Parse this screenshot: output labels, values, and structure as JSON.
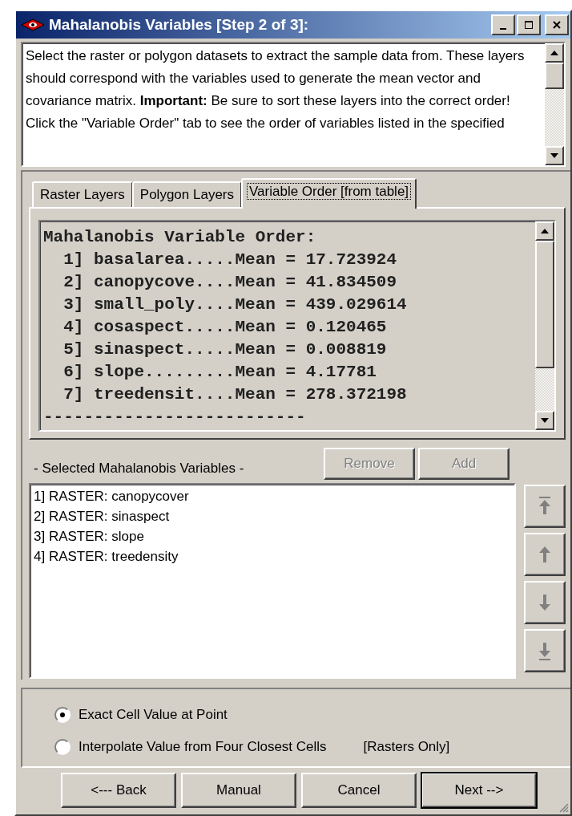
{
  "window": {
    "title": "Mahalanobis Variables [Step 2 of 3]:"
  },
  "description": {
    "text": "Select the raster or polygon datasets to extract the sample data from.  These layers should correspond with the variables used to generate the mean vector and covariance matrix. **Important:**  Be sure to sort these layers into the correct order!  Click the \"Variable Order\" tab to see the order of variables listed in the specified"
  },
  "tabs": [
    {
      "label": "Raster Layers",
      "selected": false
    },
    {
      "label": "Polygon Layers",
      "selected": false
    },
    {
      "label": "Variable Order [from table]",
      "selected": true
    }
  ],
  "variable_order": {
    "lines": [
      "Mahalanobis Variable Order:",
      "  1] basalarea.....Mean = 17.723924",
      "  2] canopycove....Mean = 41.834509",
      "  3] small_poly....Mean = 439.029614",
      "  4] cosaspect.....Mean = 0.120465",
      "  5] sinaspect.....Mean = 0.008819",
      "  6] slope.........Mean = 4.17781",
      "  7] treedensit....Mean = 278.372198",
      "--------------------------"
    ]
  },
  "selected_variables": {
    "label": "- Selected Mahalanobis Variables -",
    "buttons": [
      {
        "label": "Remove",
        "disabled": true
      },
      {
        "label": "Add",
        "disabled": true
      }
    ],
    "items": [
      "1] RASTER: canopycover",
      "2] RASTER: sinaspect",
      "3] RASTER: slope",
      "4] RASTER: treedensity"
    ]
  },
  "sampling": {
    "options": [
      {
        "label": "Exact Cell Value at Point",
        "selected": true
      },
      {
        "label": "Interpolate Value from Four Closest Cells",
        "selected": false
      }
    ],
    "note": "[Rasters Only]"
  },
  "buttons": [
    {
      "label": "<--- Back",
      "default": false
    },
    {
      "label": "Manual",
      "default": false
    },
    {
      "label": "Cancel",
      "default": false
    },
    {
      "label": "Next -->",
      "default": true
    }
  ]
}
